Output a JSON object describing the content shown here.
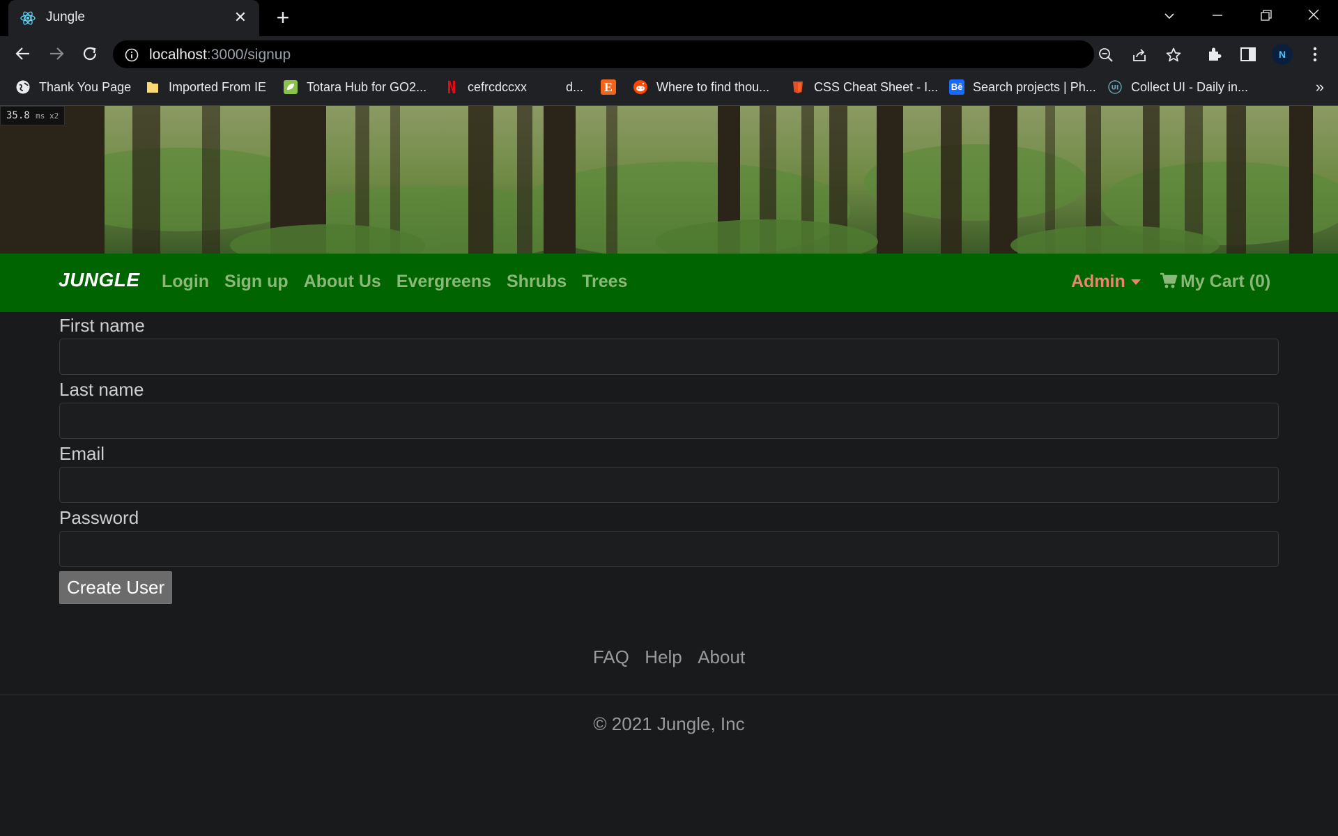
{
  "browser": {
    "tab": {
      "title": "Jungle",
      "close_glyph": "✕"
    },
    "new_tab_glyph": "+",
    "address": {
      "host": "localhost",
      "path": ":3000/signup"
    },
    "bookmarks": [
      {
        "label": "Thank You Page",
        "icon": "globe-icon",
        "color": "#ffffff"
      },
      {
        "label": "Imported From IE",
        "icon": "folder-icon",
        "color": "#f9d878"
      },
      {
        "label": "Totara Hub for GO2...",
        "icon": "leaf-icon",
        "color": "#8bc34a"
      },
      {
        "label": "cefrcdccxx",
        "icon": "netflix-icon",
        "color": "#e50914"
      },
      {
        "label": "d...",
        "icon": "blank-icon",
        "color": "#202124"
      },
      {
        "label": "",
        "icon": "etsy-icon",
        "color": "#f1641e"
      },
      {
        "label": "Where to find thou...",
        "icon": "reddit-icon",
        "color": "#ff4500"
      },
      {
        "label": "CSS Cheat Sheet - I...",
        "icon": "css-icon",
        "color": "#e44d26"
      },
      {
        "label": "Search projects | Ph...",
        "icon": "behance-icon",
        "color": "#1769ff"
      },
      {
        "label": "Collect UI - Daily in...",
        "icon": "collectui-icon",
        "color": "#6aa6b8"
      }
    ],
    "bookmarks_more": "»",
    "profile_initial": "N"
  },
  "page": {
    "perf": {
      "value": "35.8",
      "unit": "ms x2"
    },
    "navbar": {
      "brand": "JUNGLE",
      "links": [
        "Login",
        "Sign up",
        "About Us",
        "Evergreens",
        "Shrubs",
        "Trees"
      ],
      "admin": "Admin",
      "cart": "My Cart (0)"
    },
    "form": {
      "fields": [
        {
          "label": "First name",
          "value": ""
        },
        {
          "label": "Last name",
          "value": ""
        },
        {
          "label": "Email",
          "value": ""
        },
        {
          "label": "Password",
          "value": ""
        }
      ],
      "submit": "Create User"
    },
    "footer": {
      "links": [
        "FAQ",
        "Help",
        "About"
      ],
      "copyright": "© 2021 Jungle, Inc"
    }
  },
  "colors": {
    "navbar": "#006400",
    "admin": "#e8866f",
    "navlink": "#8ab878",
    "background": "#191a1c"
  }
}
